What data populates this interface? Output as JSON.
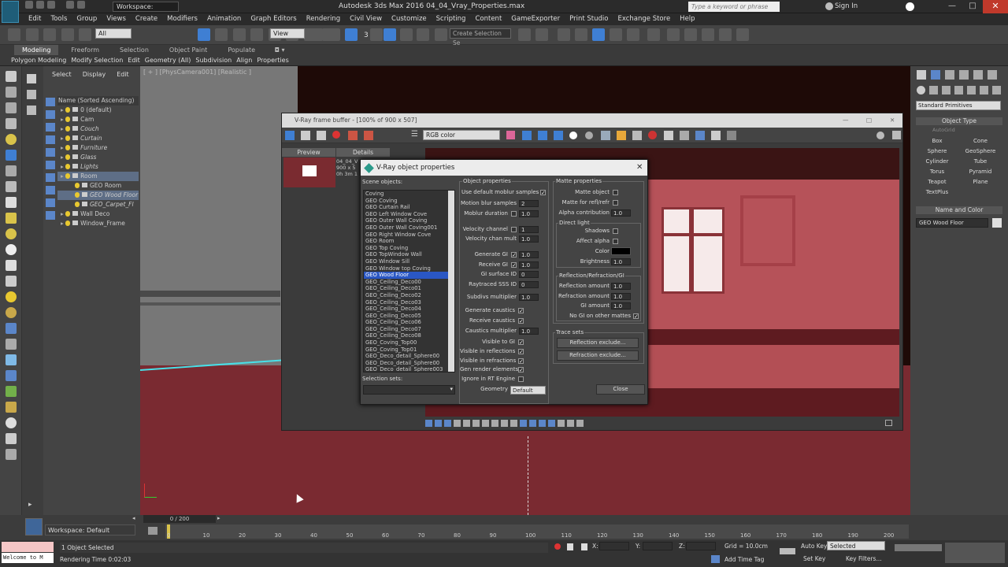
{
  "title_bar": {
    "workspace": "Workspace: Default",
    "app_title": "Autodesk 3ds Max 2016    04_04_Vray_Properties.max",
    "search_placeholder": "Type a keyword or phrase",
    "sign_in": "Sign In"
  },
  "menu": [
    "Edit",
    "Tools",
    "Group",
    "Views",
    "Create",
    "Modifiers",
    "Animation",
    "Graph Editors",
    "Rendering",
    "Civil View",
    "Customize",
    "Scripting",
    "Content",
    "GameExporter",
    "Print Studio",
    "Exchange Store",
    "Help"
  ],
  "toolbar": {
    "selection_filter": "All",
    "view_dropdown": "View",
    "num_3": "3",
    "selection_set": "Create Selection Se"
  },
  "ribbon": {
    "tabs": [
      "Modeling",
      "Freeform",
      "Selection",
      "Object Paint",
      "Populate"
    ],
    "subtabs": [
      "Polygon Modeling",
      "Modify Selection",
      "Edit",
      "Geometry (All)",
      "Subdivision",
      "Align",
      "Properties"
    ]
  },
  "explorer": {
    "tabs": [
      "Select",
      "Display",
      "Edit"
    ],
    "column_header": "Name (Sorted Ascending)",
    "rows": [
      {
        "label": "0 (default)",
        "indent": 1,
        "italic": false,
        "selected": false
      },
      {
        "label": "Cam",
        "indent": 1,
        "italic": false,
        "selected": false
      },
      {
        "label": "Couch",
        "indent": 1,
        "italic": true,
        "selected": false
      },
      {
        "label": "Curtain",
        "indent": 1,
        "italic": true,
        "selected": false
      },
      {
        "label": "Furniture",
        "indent": 1,
        "italic": true,
        "selected": false
      },
      {
        "label": "Glass",
        "indent": 1,
        "italic": true,
        "selected": false
      },
      {
        "label": "Lights",
        "indent": 1,
        "italic": true,
        "selected": false
      },
      {
        "label": "Room",
        "indent": 1,
        "italic": false,
        "selected": true
      },
      {
        "label": "GEO Room",
        "indent": 2,
        "italic": false,
        "selected": false
      },
      {
        "label": "GEO Wood Floor",
        "indent": 2,
        "italic": true,
        "selected": true
      },
      {
        "label": "GEO_Carpet_Fl",
        "indent": 2,
        "italic": true,
        "selected": false
      },
      {
        "label": "Wall Deco",
        "indent": 1,
        "italic": false,
        "selected": false
      },
      {
        "label": "Window_Frame",
        "indent": 1,
        "italic": false,
        "selected": false
      }
    ],
    "workspace_label": "Workspace: Default"
  },
  "viewport": {
    "label": "[ + ] [PhysCamera001] [Realistic ]"
  },
  "frame_buffer": {
    "title": "V-Ray frame buffer - [100% of 900 x 507]",
    "channel": "RGB color",
    "tabs": [
      "Preview",
      "Details"
    ],
    "thumb_name": "04_04_V",
    "thumb_size": "900 x 5",
    "thumb_time": "0h 3m 1"
  },
  "dialog": {
    "title": "V-Ray object properties",
    "scene_objects_label": "Scene objects:",
    "objects": [
      "Coving",
      "GEO Coving",
      "GEO Curtain Rail",
      "GEO Left Window Cove",
      "GEO Outer Wall Coving",
      "GEO Outer Wall Coving001",
      "GEO Right Window Cove",
      "GEO Room",
      "GEO Top Coving",
      "GEO TopWindow Wall",
      "GEO Window Sill",
      "GEO Window top Coving",
      "GEO Wood Floor",
      "GEO_Ceiling_Deco00",
      "GEO_Ceiling_Deco01",
      "GEO_Ceiling_Deco02",
      "GEO_Ceiling_Deco03",
      "GEO_Ceiling_Deco04",
      "GEO_Ceiling_Deco05",
      "GEO_Ceiling_Deco06",
      "GEO_Ceiling_Deco07",
      "GEO_Ceiling_Deco08",
      "GEO_Coving_Top00",
      "GEO_Coving_Top01",
      "GEO_Deco_detail_Sphere00",
      "GEO_Deco_detail_Sphere00",
      "GEO_Deco_detail_Sphere003"
    ],
    "selected_object": "GEO Wood Floor",
    "selection_sets_label": "Selection sets:",
    "object_properties": {
      "header": "Object properties",
      "use_default_moblur": "Use default moblur samples",
      "motion_blur_samples": "Motion blur samples",
      "motion_blur_samples_val": "2",
      "moblur_duration": "Moblur duration",
      "moblur_duration_val": "1.0",
      "velocity_channel": "Velocity channel",
      "velocity_channel_val": "1",
      "velocity_chan_mult": "Velocity chan mult",
      "velocity_chan_mult_val": "1.0",
      "generate_gi": "Generate GI",
      "generate_gi_val": "1.0",
      "receive_gi": "Receive GI",
      "receive_gi_val": "1.0",
      "gi_surface_id": "GI surface ID",
      "gi_surface_id_val": "0",
      "raytraced_sss_id": "Raytraced SSS ID",
      "raytraced_sss_id_val": "0",
      "subdivs_multiplier": "Subdivs multiplier",
      "subdivs_multiplier_val": "1.0",
      "generate_caustics": "Generate caustics",
      "receive_caustics": "Receive caustics",
      "caustics_multiplier": "Caustics multiplier",
      "caustics_multiplier_val": "1.0",
      "visible_to_gi": "Visible to GI",
      "visible_in_reflections": "Visible in reflections",
      "visible_in_refractions": "Visible in refractions",
      "gen_render_elements": "Gen render elements",
      "ignore_in_rt_engine": "Ignore in RT Engine",
      "geometry": "Geometry",
      "geometry_val": "Default"
    },
    "matte_properties": {
      "header": "Matte properties",
      "matte_object": "Matte object",
      "matte_for_refl_refr": "Matte for refl/refr",
      "alpha_contribution": "Alpha contribution",
      "alpha_contribution_val": "1.0",
      "direct_light": "Direct light",
      "shadows": "Shadows",
      "affect_alpha": "Affect alpha",
      "color": "Color",
      "brightness": "Brightness",
      "brightness_val": "1.0",
      "rrgi": "Reflection/Refraction/GI",
      "reflection_amount": "Reflection amount",
      "reflection_amount_val": "1.0",
      "refraction_amount": "Refraction amount",
      "refraction_amount_val": "1.0",
      "gi_amount": "GI amount",
      "gi_amount_val": "1.0",
      "no_gi_on_other_mattes": "No GI on other mattes"
    },
    "trace_sets": {
      "header": "Trace sets",
      "reflection_exclude": "Reflection exclude...",
      "refraction_exclude": "Refraction exclude..."
    },
    "close": "Close"
  },
  "command_panel": {
    "dropdown": "Standard Primitives",
    "object_type": "Object Type",
    "autogrid": "AutoGrid",
    "buttons": [
      "Box",
      "Cone",
      "Sphere",
      "GeoSphere",
      "Cylinder",
      "Tube",
      "Torus",
      "Pyramid",
      "Teapot",
      "Plane",
      "TextPlus"
    ],
    "name_and_color": "Name and Color",
    "name_value": "GEO Wood Floor"
  },
  "timeline": {
    "frame": "0 / 200",
    "ticks": [
      "0",
      "10",
      "20",
      "30",
      "40",
      "50",
      "60",
      "70",
      "80",
      "90",
      "100",
      "110",
      "120",
      "130",
      "140",
      "150",
      "160",
      "170",
      "180",
      "190",
      "200"
    ]
  },
  "status": {
    "maxscript": "Welcome to M",
    "selected": "1 Object Selected",
    "render_time": "Rendering Time  0:02:03",
    "x_label": "X:",
    "y_label": "Y:",
    "z_label": "Z:",
    "grid": "Grid = 10.0cm",
    "add_time_tag": "Add Time Tag",
    "auto_key": "Auto Key",
    "auto_key_val": "Selected",
    "set_key": "Set Key",
    "key_filters": "Key Filters..."
  }
}
